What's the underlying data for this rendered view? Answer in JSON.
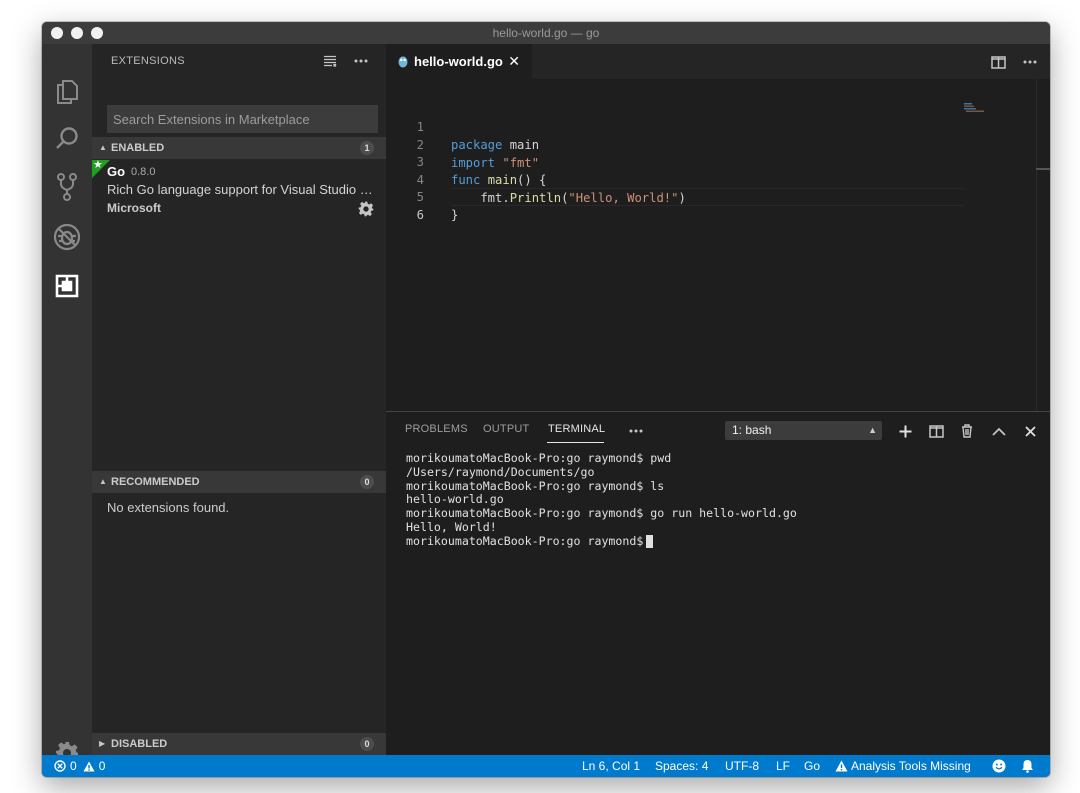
{
  "window": {
    "title": "hello-world.go — go"
  },
  "activity_bar": {
    "items": [
      "explorer-icon",
      "search-icon",
      "source-control-icon",
      "debug-icon",
      "extensions-icon"
    ],
    "bottom": "manage-gear-icon"
  },
  "sidebar": {
    "title": "EXTENSIONS",
    "search_placeholder": "Search Extensions in Marketplace",
    "enabled": {
      "label": "ENABLED",
      "count": "1",
      "items": [
        {
          "name": "Go",
          "version": "0.8.0",
          "description": "Rich Go language support for Visual Studio Code",
          "publisher": "Microsoft"
        }
      ]
    },
    "recommended": {
      "label": "RECOMMENDED",
      "count": "0",
      "empty_text": "No extensions found."
    },
    "disabled": {
      "label": "DISABLED",
      "count": "0"
    }
  },
  "editor": {
    "tab_label": "hello-world.go",
    "lines": [
      {
        "n": "1",
        "text": "package main"
      },
      {
        "n": "2",
        "text": "import \"fmt\""
      },
      {
        "n": "3",
        "text": "func main() {"
      },
      {
        "n": "4",
        "text": "    fmt.Println(\"Hello, World!\")"
      },
      {
        "n": "5",
        "text": "}"
      },
      {
        "n": "6",
        "text": ""
      }
    ],
    "code": {
      "l1_kw": "package",
      "l1_rest": " main",
      "l2_kw": "import",
      "l2_str": " \"fmt\"",
      "l3_kw": "func",
      "l3_fn": " main",
      "l3_rest": "() {",
      "l4_obj": "    fmt.",
      "l4_fn": "Println",
      "l4_open": "(",
      "l4_str": "\"Hello, World!\"",
      "l4_close": ")",
      "l5": "}"
    }
  },
  "panel": {
    "tabs": [
      "PROBLEMS",
      "OUTPUT",
      "TERMINAL"
    ],
    "active_tab": "TERMINAL",
    "terminal_select": "1: bash",
    "terminal_lines": [
      "morikoumatoMacBook-Pro:go raymond$ pwd",
      "/Users/raymond/Documents/go",
      "morikoumatoMacBook-Pro:go raymond$ ls",
      "hello-world.go",
      "morikoumatoMacBook-Pro:go raymond$ go run hello-world.go",
      "Hello, World!",
      "morikoumatoMacBook-Pro:go raymond$"
    ]
  },
  "status_bar": {
    "errors": "0",
    "warnings": "0",
    "position": "Ln 6, Col 1",
    "spaces": "Spaces: 4",
    "encoding": "UTF-8",
    "eol": "LF",
    "language": "Go",
    "analysis": "Analysis Tools Missing",
    "color": "#007acc"
  }
}
